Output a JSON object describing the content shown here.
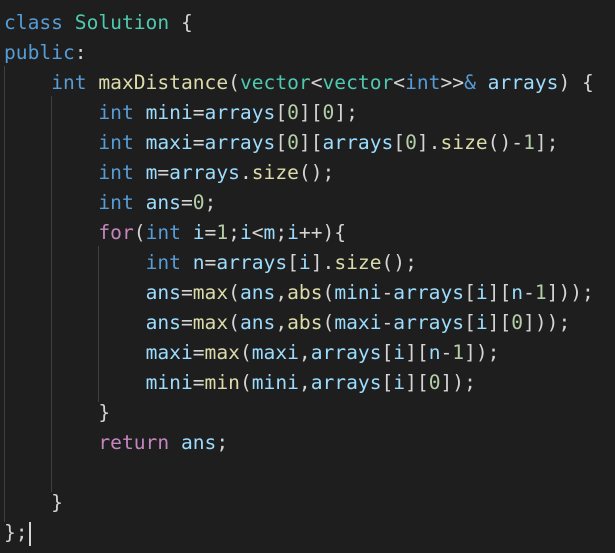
{
  "editor": {
    "language": "cpp",
    "theme_colors": {
      "background": "#1e1e1e",
      "keyword": "#569cd6",
      "control": "#c586c0",
      "type": "#4ec9b0",
      "function": "#dcdcaa",
      "variable": "#9cdcfe",
      "number": "#b5cea8",
      "text": "#d4d4d4",
      "indent_guide": "#404040"
    },
    "lines": [
      [
        [
          "k",
          "class"
        ],
        [
          "p",
          " "
        ],
        [
          "t",
          "Solution"
        ],
        [
          "p",
          " {"
        ]
      ],
      [
        [
          "k",
          "public"
        ],
        [
          "p",
          ":"
        ]
      ],
      [
        [
          "p",
          "    "
        ],
        [
          "k",
          "int"
        ],
        [
          "p",
          " "
        ],
        [
          "f",
          "maxDistance"
        ],
        [
          "p",
          "("
        ],
        [
          "t",
          "vector"
        ],
        [
          "p",
          "<"
        ],
        [
          "t",
          "vector"
        ],
        [
          "p",
          "<"
        ],
        [
          "k",
          "int"
        ],
        [
          "p",
          ">>"
        ],
        [
          "k",
          "&"
        ],
        [
          "p",
          " "
        ],
        [
          "v",
          "arrays"
        ],
        [
          "p",
          ") {"
        ]
      ],
      [
        [
          "p",
          "        "
        ],
        [
          "k",
          "int"
        ],
        [
          "p",
          " "
        ],
        [
          "v",
          "mini"
        ],
        [
          "p",
          "="
        ],
        [
          "v",
          "arrays"
        ],
        [
          "p",
          "["
        ],
        [
          "n",
          "0"
        ],
        [
          "p",
          "]["
        ],
        [
          "n",
          "0"
        ],
        [
          "p",
          "];"
        ]
      ],
      [
        [
          "p",
          "        "
        ],
        [
          "k",
          "int"
        ],
        [
          "p",
          " "
        ],
        [
          "v",
          "maxi"
        ],
        [
          "p",
          "="
        ],
        [
          "v",
          "arrays"
        ],
        [
          "p",
          "["
        ],
        [
          "n",
          "0"
        ],
        [
          "p",
          "]["
        ],
        [
          "v",
          "arrays"
        ],
        [
          "p",
          "["
        ],
        [
          "n",
          "0"
        ],
        [
          "p",
          "]."
        ],
        [
          "f",
          "size"
        ],
        [
          "p",
          "()-"
        ],
        [
          "n",
          "1"
        ],
        [
          "p",
          "];"
        ]
      ],
      [
        [
          "p",
          "        "
        ],
        [
          "k",
          "int"
        ],
        [
          "p",
          " "
        ],
        [
          "v",
          "m"
        ],
        [
          "p",
          "="
        ],
        [
          "v",
          "arrays"
        ],
        [
          "p",
          "."
        ],
        [
          "f",
          "size"
        ],
        [
          "p",
          "();"
        ]
      ],
      [
        [
          "p",
          "        "
        ],
        [
          "k",
          "int"
        ],
        [
          "p",
          " "
        ],
        [
          "v",
          "ans"
        ],
        [
          "p",
          "="
        ],
        [
          "n",
          "0"
        ],
        [
          "p",
          ";"
        ]
      ],
      [
        [
          "p",
          "        "
        ],
        [
          "c",
          "for"
        ],
        [
          "p",
          "("
        ],
        [
          "k",
          "int"
        ],
        [
          "p",
          " "
        ],
        [
          "v",
          "i"
        ],
        [
          "p",
          "="
        ],
        [
          "n",
          "1"
        ],
        [
          "p",
          ";"
        ],
        [
          "v",
          "i"
        ],
        [
          "p",
          "<"
        ],
        [
          "v",
          "m"
        ],
        [
          "p",
          ";"
        ],
        [
          "v",
          "i"
        ],
        [
          "p",
          "++){"
        ]
      ],
      [
        [
          "p",
          "            "
        ],
        [
          "k",
          "int"
        ],
        [
          "p",
          " "
        ],
        [
          "v",
          "n"
        ],
        [
          "p",
          "="
        ],
        [
          "v",
          "arrays"
        ],
        [
          "p",
          "["
        ],
        [
          "v",
          "i"
        ],
        [
          "p",
          "]."
        ],
        [
          "f",
          "size"
        ],
        [
          "p",
          "();"
        ]
      ],
      [
        [
          "p",
          "            "
        ],
        [
          "v",
          "ans"
        ],
        [
          "p",
          "="
        ],
        [
          "f",
          "max"
        ],
        [
          "p",
          "("
        ],
        [
          "v",
          "ans"
        ],
        [
          "p",
          ","
        ],
        [
          "f",
          "abs"
        ],
        [
          "p",
          "("
        ],
        [
          "v",
          "mini"
        ],
        [
          "p",
          "-"
        ],
        [
          "v",
          "arrays"
        ],
        [
          "p",
          "["
        ],
        [
          "v",
          "i"
        ],
        [
          "p",
          "]["
        ],
        [
          "v",
          "n"
        ],
        [
          "p",
          "-"
        ],
        [
          "n",
          "1"
        ],
        [
          "p",
          "]));"
        ]
      ],
      [
        [
          "p",
          "            "
        ],
        [
          "v",
          "ans"
        ],
        [
          "p",
          "="
        ],
        [
          "f",
          "max"
        ],
        [
          "p",
          "("
        ],
        [
          "v",
          "ans"
        ],
        [
          "p",
          ","
        ],
        [
          "f",
          "abs"
        ],
        [
          "p",
          "("
        ],
        [
          "v",
          "maxi"
        ],
        [
          "p",
          "-"
        ],
        [
          "v",
          "arrays"
        ],
        [
          "p",
          "["
        ],
        [
          "v",
          "i"
        ],
        [
          "p",
          "]["
        ],
        [
          "n",
          "0"
        ],
        [
          "p",
          "]));"
        ]
      ],
      [
        [
          "p",
          "            "
        ],
        [
          "v",
          "maxi"
        ],
        [
          "p",
          "="
        ],
        [
          "f",
          "max"
        ],
        [
          "p",
          "("
        ],
        [
          "v",
          "maxi"
        ],
        [
          "p",
          ","
        ],
        [
          "v",
          "arrays"
        ],
        [
          "p",
          "["
        ],
        [
          "v",
          "i"
        ],
        [
          "p",
          "]["
        ],
        [
          "v",
          "n"
        ],
        [
          "p",
          "-"
        ],
        [
          "n",
          "1"
        ],
        [
          "p",
          "]);"
        ]
      ],
      [
        [
          "p",
          "            "
        ],
        [
          "v",
          "mini"
        ],
        [
          "p",
          "="
        ],
        [
          "f",
          "min"
        ],
        [
          "p",
          "("
        ],
        [
          "v",
          "mini"
        ],
        [
          "p",
          ","
        ],
        [
          "v",
          "arrays"
        ],
        [
          "p",
          "["
        ],
        [
          "v",
          "i"
        ],
        [
          "p",
          "]["
        ],
        [
          "n",
          "0"
        ],
        [
          "p",
          "]);"
        ]
      ],
      [
        [
          "p",
          "        }"
        ]
      ],
      [
        [
          "p",
          "        "
        ],
        [
          "c",
          "return"
        ],
        [
          "p",
          " "
        ],
        [
          "v",
          "ans"
        ],
        [
          "p",
          ";"
        ]
      ],
      [],
      [
        [
          "p",
          "    }"
        ]
      ],
      [
        [
          "p",
          "};"
        ]
      ]
    ]
  }
}
